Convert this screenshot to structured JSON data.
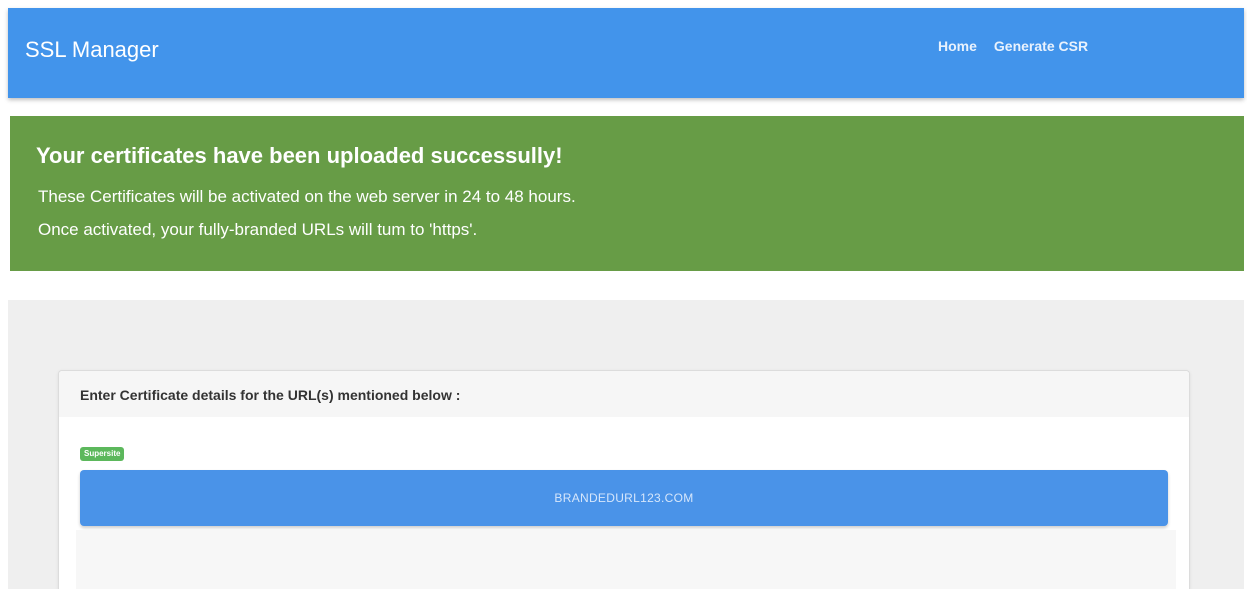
{
  "navbar": {
    "brand": "SSL Manager",
    "links": [
      {
        "label": "Home"
      },
      {
        "label": "Generate CSR"
      }
    ]
  },
  "alert": {
    "title": "Your certificates have been uploaded successully!",
    "lines": [
      "These Certificates will be activated on the web server in 24 to 48 hours.",
      "Once activated, your fully-branded URLs will tum to 'https'."
    ]
  },
  "card": {
    "title": "Enter Certificate details for the URL(s) mentioned below :",
    "badge": "Supersite",
    "url": "BRANDEDURL123.COM"
  },
  "colors": {
    "navbar": "#4294eb",
    "alert_success": "#679c46",
    "url_bar": "#4a93e8",
    "badge": "#5cb85c"
  }
}
